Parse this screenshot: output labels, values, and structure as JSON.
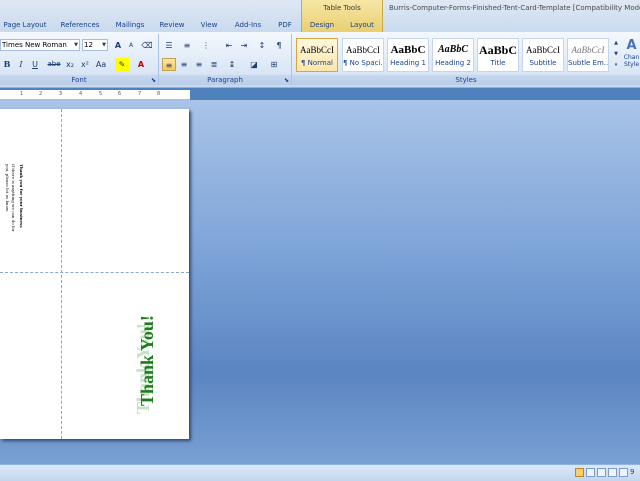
{
  "tabs": [
    "Page Layout",
    "References",
    "Mailings",
    "Review",
    "View",
    "Add-Ins",
    "PDF"
  ],
  "table_tools": {
    "label": "Table Tools",
    "tabs": [
      "Design",
      "Layout"
    ]
  },
  "window_title": "Burris-Computer-Forms-Finished-Tent-Card-Template [Compatibility Mode] - M",
  "font_group": {
    "label": "Font",
    "font_name": "Times New Roman",
    "font_size": "12",
    "bold": "B",
    "italic": "I",
    "underline": "U",
    "strike": "abe",
    "subscript": "x₂",
    "superscript": "x²",
    "change_case": "Aa",
    "grow": "A",
    "shrink": "A",
    "font_color": "A"
  },
  "paragraph_group": {
    "label": "Paragraph",
    "show_marks": "¶"
  },
  "styles_group": {
    "label": "Styles",
    "items": [
      {
        "preview": "AaBbCcI",
        "name": "¶ Normal"
      },
      {
        "preview": "AaBbCcI",
        "name": "¶ No Spaci..."
      },
      {
        "preview": "AaBbC",
        "name": "Heading 1"
      },
      {
        "preview": "AaBbC",
        "name": "Heading 2"
      },
      {
        "preview": "AaBbC",
        "name": "Title"
      },
      {
        "preview": "AaBbCcI",
        "name": "Subtitle"
      },
      {
        "preview": "AaBbCcI",
        "name": "Subtle Em..."
      }
    ],
    "change_styles": [
      "Chan",
      "Style"
    ]
  },
  "ruler": {
    "marks": [
      "1",
      "2",
      "3",
      "4",
      "5",
      "6",
      "7",
      "8"
    ]
  },
  "document": {
    "inside_lines": [
      "Thank you for your business",
      "If there is anything we can do for",
      "you, please let us know."
    ],
    "outside_text": "Thank You!",
    "outside_color": "#1e7b1e"
  },
  "status": {
    "zoom": "9"
  }
}
